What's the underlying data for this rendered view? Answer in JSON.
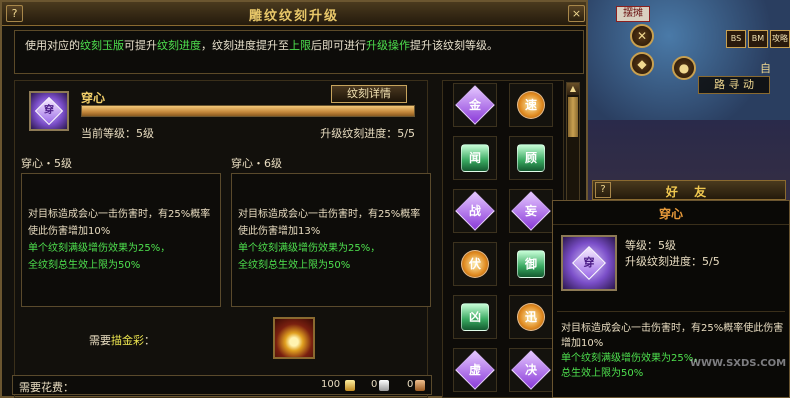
{
  "window": {
    "title": "雕纹纹刻升级",
    "help_label": "?",
    "close_label": "×"
  },
  "info": {
    "p1": "使用对应的",
    "h1": "纹刻玉版",
    "p2": "可提升",
    "h2": "纹刻进度",
    "p3": "，纹刻进度提升至",
    "h3": "上限",
    "p4": "后即可进行",
    "h4": "升级操作",
    "p5": "提升该纹刻等级。"
  },
  "skill": {
    "icon_char": "穿",
    "name": "穿心",
    "detail_button": "纹刻详情",
    "progress_fraction": 1.0,
    "current_level": "当前等级：5级",
    "progress_text": "升级纹刻进度：5/5"
  },
  "current": {
    "title": "穿心・5级",
    "line1": "对目标造成会心一击伤害时，有25%概率使此伤害增加10%",
    "line2": "单个纹刻满级增伤效果为25%，",
    "line3": "全纹刻总生效上限为50%"
  },
  "next": {
    "title": "穿心・6级",
    "line1": "对目标造成会心一击伤害时，有25%概率使此伤害增加13%",
    "line2": "单个纹刻满级增伤效果为25%，",
    "line3": "全纹刻总生效上限为50%"
  },
  "need": {
    "label": "需要",
    "item": "描金彩",
    "suffix": "："
  },
  "cost": {
    "label": "需要花费：",
    "gold": "100",
    "silver": "0",
    "copper": "0"
  },
  "gems": [
    {
      "char": "金",
      "style": "purple"
    },
    {
      "char": "速",
      "style": "orange"
    },
    {
      "char": "闻",
      "style": "green"
    },
    {
      "char": "顾",
      "style": "green"
    },
    {
      "char": "战",
      "style": "purple"
    },
    {
      "char": "妄",
      "style": "purple"
    },
    {
      "char": "伏",
      "style": "orange"
    },
    {
      "char": "御",
      "style": "green"
    },
    {
      "char": "凶",
      "style": "green"
    },
    {
      "char": "迅",
      "style": "orange"
    },
    {
      "char": "虚",
      "style": "purple"
    },
    {
      "char": "决",
      "style": "purple"
    }
  ],
  "scene": {
    "map_chip": "摆摊",
    "btn_bs": "BS",
    "btn_bm": "BM",
    "btn_jl": "攻略",
    "nav_label": "路 寻 动",
    "self_label": "自",
    "friend_title": "好 友",
    "friend_q": "?"
  },
  "tooltip": {
    "title": "穿心",
    "icon_char": "穿",
    "level": "等级：5级",
    "progress": "升级纹刻进度：5/5",
    "line1": "对目标造成会心一击伤害时，有25%概率使此伤害增加10%",
    "line2": "单个纹刻满级增伤效果为25%，",
    "line3": "总生效上限为50%"
  },
  "watermark": "WWW.SXDS.COM"
}
